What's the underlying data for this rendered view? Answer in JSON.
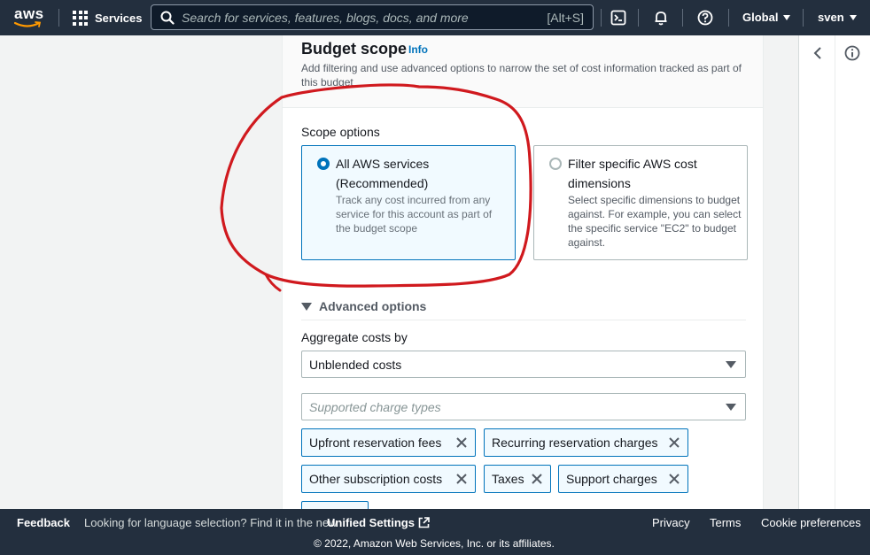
{
  "nav": {
    "logo_text": "aws",
    "services_label": "Services",
    "search_placeholder": "Search for services, features, blogs, docs, and more",
    "search_shortcut": "[Alt+S]",
    "region_label": "Global",
    "user_label": "sven"
  },
  "budget_scope": {
    "title": "Budget scope",
    "info_link": "Info",
    "description": "Add filtering and use advanced options to narrow the set of cost information tracked as part of this budget",
    "scope_options_label": "Scope options",
    "options": [
      {
        "title": "All AWS services (Recommended)",
        "description": "Track any cost incurred from any service for this account as part of the budget scope",
        "selected": true
      },
      {
        "title": "Filter specific AWS cost dimensions",
        "description": "Select specific dimensions to budget against. For example, you can select the specific service \"EC2\" to budget against.",
        "selected": false
      }
    ],
    "advanced_options_label": "Advanced options",
    "aggregate_label": "Aggregate costs by",
    "aggregate_value": "Unblended costs",
    "charge_types_placeholder": "Supported charge types",
    "tokens": [
      "Upfront reservation fees",
      "Recurring reservation charges",
      "Other subscription costs",
      "Taxes",
      "Support charges"
    ]
  },
  "footer": {
    "feedback": "Feedback",
    "lang_prompt": "Looking for language selection? Find it in the new",
    "unified_settings": "Unified Settings",
    "privacy": "Privacy",
    "terms": "Terms",
    "cookie_preferences": "Cookie preferences",
    "copyright": "© 2022, Amazon Web Services, Inc. or its affiliates."
  },
  "colors": {
    "nav_bg": "#232f3e",
    "accent_blue": "#0073bb",
    "annotation_red": "#d0191e"
  },
  "icons": [
    "grid-icon",
    "search-icon",
    "cloudshell-icon",
    "bell-icon",
    "help-icon",
    "chevron-left-icon",
    "info-circle-icon",
    "external-link-icon",
    "close-icon"
  ]
}
